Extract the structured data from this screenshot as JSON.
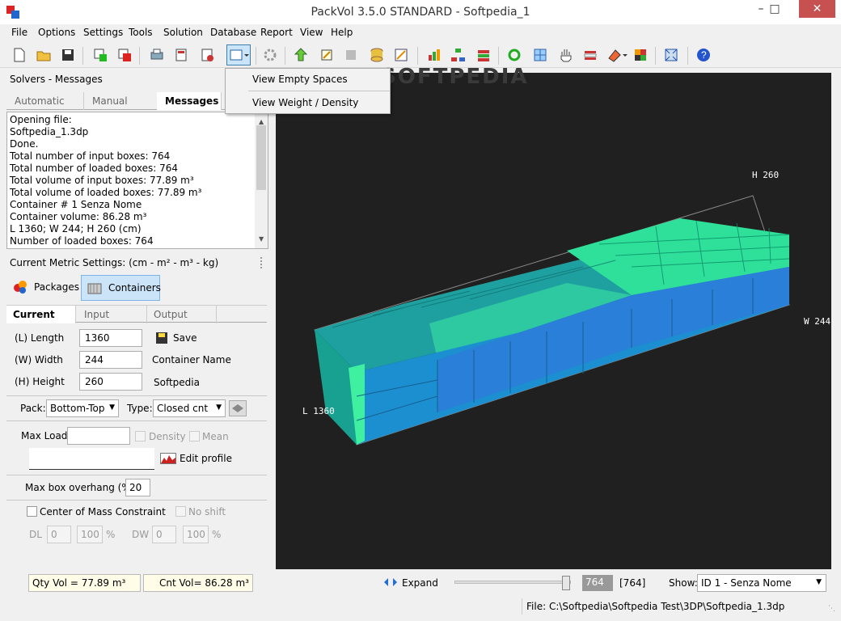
{
  "window": {
    "title": "PackVol 3.5.0 STANDARD - Softpedia_1"
  },
  "menu": [
    "File",
    "Options",
    "Settings",
    "Tools",
    "Solution",
    "Database",
    "Report",
    "View",
    "Help"
  ],
  "dropdown": {
    "items": [
      "View Empty Spaces",
      "View Weight / Density"
    ]
  },
  "solvers": {
    "header": "Solvers - Messages",
    "tabs": [
      "Automatic",
      "Manual",
      "Messages"
    ],
    "active_tab": "Messages",
    "messages": [
      "Opening file:",
      "Softpedia_1.3dp",
      "Done.",
      "Total number of input boxes: 764",
      "Total number of loaded boxes:  764",
      "Total volume of input boxes: 77.89 m³",
      "Total volume of loaded boxes: 77.89 m³",
      "Container # 1 Senza Nome",
      "Container volume: 86.28 m³",
      "L 1360; W 244; H 260 (cm)",
      "Number of loaded boxes: 764"
    ]
  },
  "metric": {
    "label": "Current Metric Settings: (cm - m² - m³ - kg)"
  },
  "mode_tabs": {
    "packages": "Packages",
    "containers": "Containers"
  },
  "sub_tabs": [
    "Current",
    "Input",
    "Output"
  ],
  "dims": {
    "length_label": "(L) Length",
    "length": "1360",
    "width_label": "(W) Width",
    "width": "244",
    "height_label": "(H) Height",
    "height": "260",
    "save": "Save",
    "container_name_label": "Container Name",
    "container_name": "Softpedia"
  },
  "pack": {
    "label": "Pack:",
    "value": "Bottom-Top",
    "type_label": "Type:",
    "type_value": "Closed cnt"
  },
  "load": {
    "max_load_label": "Max Load",
    "max_load": "",
    "density": "Density",
    "mean": "Mean",
    "edit_profile": "Edit profile"
  },
  "overhang": {
    "label": "Max box overhang (%)",
    "value": "20"
  },
  "mass": {
    "label": "Center of Mass Constraint",
    "no_shift": "No shift",
    "dl": "DL",
    "dl_val": "0",
    "dl_pct": "100",
    "dw": "DW",
    "dw_val": "0",
    "dw_pct": "100",
    "pct": "%"
  },
  "totals": {
    "qty_vol": "Qty Vol = 77.89 m³",
    "cnt_vol": "Cnt Vol= 86.28 m³"
  },
  "bottom": {
    "expand": "Expand",
    "slider_value": "764",
    "slider_max": "[764]",
    "slider_level": 1.0,
    "show_label": "Show:",
    "show_value": "ID 1 - Senza Nome"
  },
  "view3d": {
    "labels": {
      "h": "H 260",
      "w": "W 244",
      "l": "L 1360"
    }
  },
  "status": {
    "file": "File: C:\\Softpedia\\Softpedia Test\\3DP\\Softpedia_1.3dp"
  },
  "watermark": "SOFTPEDIA",
  "colors": {
    "accent": "#1e90ff",
    "box_green": "#2fe09a",
    "box_teal": "#1fa0a0",
    "box_blue": "#2a7fd8"
  }
}
